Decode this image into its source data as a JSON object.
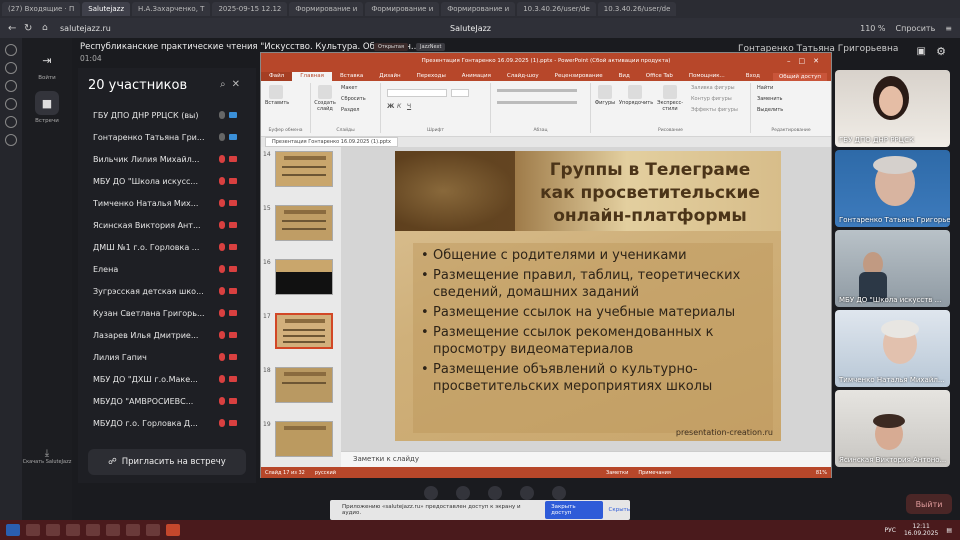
{
  "browser": {
    "tabs": [
      "(27) Входящие · П",
      "Salutejazz",
      "Н.А.Захарченко, Т",
      "2025-09-15 12.12",
      "Формирование и",
      "Формирование и",
      "Формирование и",
      "10.3.40.26/user/de",
      "10.3.40.26/user/de"
    ],
    "active_tab": 1,
    "url": "salutejazz.ru",
    "page_title": "SaluteJazz",
    "zoom": "110 %",
    "ask_label": "Спросить"
  },
  "rail": {
    "items": [
      {
        "label": "Войти",
        "icon": "login-icon"
      },
      {
        "label": "Встречи",
        "icon": "video-icon"
      }
    ],
    "download_label": "Скачать SaluteJazz"
  },
  "meeting": {
    "title": "Республиканские практические чтения \"Искусство. Культура. Образован...",
    "time": "01:04",
    "badges": [
      "Открытая",
      "JazzNext"
    ],
    "speaker": "Гонтаренко Татьяна Григорьевна"
  },
  "participants": {
    "header": "20 участников",
    "list": [
      "ГБУ ДПО ДНР РРЦСК (вы)",
      "Гонтаренко Татьяна Гри...",
      "Вильчик Лилия Михайл...",
      "МБУ ДО \"Школа искусс...",
      "Тимченко Наталья Мих...",
      "Ясинская Виктория Ант...",
      "ДМШ №1 г.о. Горловка ...",
      "Елена",
      "Зугрэсская детская шко...",
      "Кузан Светлана Григорь...",
      "Лазарев Илья Дмитрие...",
      "Лилия Гапич",
      "МБУ ДО \"ДХШ г.о.Маке...",
      "МБУДО \"АМВРОСИЕВС...",
      "МБУДО г.о. Горловка Д..."
    ],
    "invite_label": "Пригласить на встречу"
  },
  "ppt": {
    "window_title": "Презентация Гонтаренко 16.09.2025 (1).pptx - PowerPoint (Сбой активации продукта)",
    "menu_tabs": [
      "Файл",
      "Главная",
      "Вставка",
      "Дизайн",
      "Переходы",
      "Анимация",
      "Слайд-шоу",
      "Рецензирование",
      "Вид",
      "Office Tab",
      "Помощник..."
    ],
    "menu_right": [
      "Вход",
      "Общий доступ"
    ],
    "ribbon_groups": [
      "Буфер обмена",
      "Слайды",
      "Шрифт",
      "Абзац",
      "Рисование",
      "Редактирование"
    ],
    "ribbon_buttons": {
      "paste": "Вставить",
      "new_slide": "Создать слайд",
      "layout": "Макет",
      "reset": "Сбросить",
      "section": "Раздел",
      "shapes": "Фигуры",
      "arrange": "Упорядочить",
      "quick_styles": "Экспресс-стили",
      "find": "Найти",
      "replace": "Заменить",
      "select": "Выделить",
      "shape_fill": "Заливка фигуры",
      "shape_outline": "Контур фигуры",
      "shape_effects": "Эффекты фигуры"
    },
    "file_tab": "Презентация Гонтаренко 16.09.2025 (1).pptx",
    "thumbs": [
      14,
      15,
      16,
      17,
      18,
      19
    ],
    "selected_thumb": 17,
    "slide": {
      "title_lines": [
        "Группы в Телеграме",
        "как просветительские",
        "онлайн-платформы"
      ],
      "bullets": [
        "Общение с родителями и учениками",
        "Размещение правил, таблиц, теоретических сведений, домашних заданий",
        "Размещение ссылок на учебные материалы",
        "Размещение ссылок рекомендованных к просмотру видеоматериалов",
        "Размещение объявлений о культурно-просветительских мероприятиях школы"
      ],
      "watermark": "presentation-creation.ru"
    },
    "notes_placeholder": "Заметки к слайду",
    "status": {
      "slide": "Слайд 17 из 32",
      "lang": "русский",
      "notes": "Заметки",
      "comments": "Примечания",
      "zoom": "81%"
    }
  },
  "videos": [
    {
      "label": "ГБУ ДПО ДНР РРЦСК"
    },
    {
      "label": "Гонтаренко Татьяна Григорьевна"
    },
    {
      "label": "МБУ ДО \"Школа искусств ..."
    },
    {
      "label": "Тимченко Наталья Михайл..."
    },
    {
      "label": "Ясинская Виктория Антоно..."
    }
  ],
  "notice": {
    "text": "Приложению «salutejazz.ru» предоставлен доступ к экрану и аудио.",
    "stop": "Закрыть доступ",
    "hide": "Скрыть"
  },
  "exit_label": "Выйти",
  "taskbar": {
    "lang": "РУС",
    "time": "12:11",
    "date": "16.09.2025"
  }
}
